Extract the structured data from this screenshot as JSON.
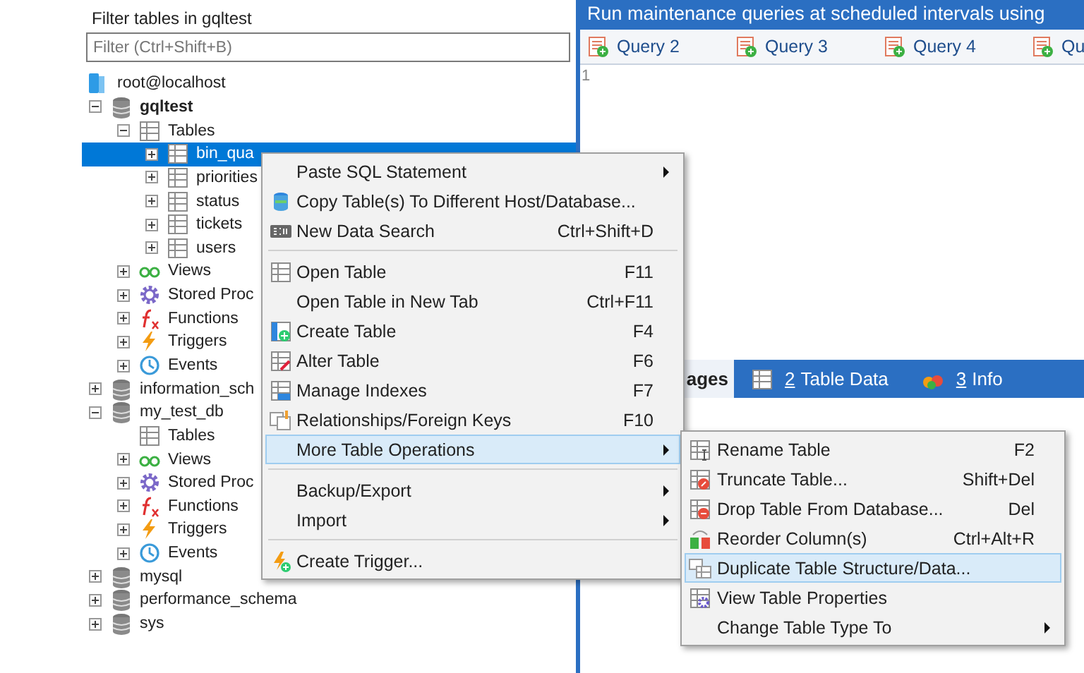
{
  "filter": {
    "label": "Filter tables in gqltest",
    "placeholder": "Filter (Ctrl+Shift+B)"
  },
  "tree": [
    {
      "label": "root@localhost",
      "kind": "server",
      "selected": false,
      "children": [
        {
          "label": "gqltest",
          "kind": "database",
          "bold": true,
          "expanded": true,
          "selected": false,
          "children": [
            {
              "label": "Tables",
              "kind": "tables",
              "expanded": true,
              "selected": false,
              "children": [
                {
                  "label": "bin_qua",
                  "kind": "table",
                  "expanded": false,
                  "selected": true
                },
                {
                  "label": "priorities",
                  "kind": "table",
                  "expanded": false,
                  "selected": false
                },
                {
                  "label": "status",
                  "kind": "table",
                  "expanded": false,
                  "selected": false
                },
                {
                  "label": "tickets",
                  "kind": "table",
                  "expanded": false,
                  "selected": false
                },
                {
                  "label": "users",
                  "kind": "table",
                  "expanded": false,
                  "selected": false
                }
              ]
            },
            {
              "label": "Views",
              "kind": "views",
              "expanded": false,
              "selected": false
            },
            {
              "label": "Stored Proc",
              "kind": "procs",
              "expanded": false,
              "selected": false
            },
            {
              "label": "Functions",
              "kind": "functions",
              "expanded": false,
              "selected": false
            },
            {
              "label": "Triggers",
              "kind": "triggers",
              "expanded": false,
              "selected": false
            },
            {
              "label": "Events",
              "kind": "events",
              "expanded": false,
              "selected": false
            }
          ]
        },
        {
          "label": "information_sch",
          "kind": "database",
          "expanded": false,
          "selected": false
        },
        {
          "label": "my_test_db",
          "kind": "database",
          "expanded": true,
          "selected": false,
          "children": [
            {
              "label": "Tables",
              "kind": "tables",
              "selected": false
            },
            {
              "label": "Views",
              "kind": "views",
              "expanded": false,
              "selected": false
            },
            {
              "label": "Stored Proc",
              "kind": "procs",
              "expanded": false,
              "selected": false
            },
            {
              "label": "Functions",
              "kind": "functions",
              "expanded": false,
              "selected": false
            },
            {
              "label": "Triggers",
              "kind": "triggers",
              "expanded": false,
              "selected": false
            },
            {
              "label": "Events",
              "kind": "events",
              "expanded": false,
              "selected": false
            }
          ]
        },
        {
          "label": "mysql",
          "kind": "database",
          "expanded": false,
          "selected": false
        },
        {
          "label": "performance_schema",
          "kind": "database",
          "expanded": false,
          "selected": false
        },
        {
          "label": "sys",
          "kind": "database",
          "expanded": false,
          "selected": false
        }
      ]
    }
  ],
  "header": {
    "title": "Run maintenance queries at scheduled intervals using"
  },
  "query_tabs": [
    {
      "label": "Query 2",
      "selected": false
    },
    {
      "label": "Query 3",
      "selected": false
    },
    {
      "label": "Query 4",
      "selected": false
    },
    {
      "label": "Qu",
      "selected": false
    }
  ],
  "editor": {
    "line_numbers": [
      "1"
    ]
  },
  "result_tabs": [
    {
      "label": "ages",
      "kind": "plain",
      "selected": true
    },
    {
      "number": "2",
      "label": "Table Data",
      "kind": "table",
      "selected": false
    },
    {
      "number": "3",
      "label": "Info",
      "kind": "info",
      "selected": false
    }
  ],
  "context_menu": {
    "items": [
      {
        "kind": "plain",
        "label": "Paste SQL Statement",
        "submenu": true,
        "selected": false
      },
      {
        "kind": "copy",
        "label": "Copy Table(s) To Different Host/Database...",
        "submenu": false,
        "selected": false
      },
      {
        "kind": "search",
        "label": "New Data Search",
        "shortcut": "Ctrl+Shift+D",
        "submenu": false,
        "selected": false
      },
      {
        "kind": "separator"
      },
      {
        "kind": "table",
        "label": "Open Table",
        "shortcut": "F11",
        "submenu": false,
        "selected": false
      },
      {
        "kind": "plain",
        "label": "Open Table in New Tab",
        "shortcut": "Ctrl+F11",
        "submenu": false,
        "selected": false
      },
      {
        "kind": "create",
        "label": "Create Table",
        "shortcut": "F4",
        "submenu": false,
        "selected": false
      },
      {
        "kind": "alter",
        "label": "Alter Table",
        "shortcut": "F6",
        "submenu": false,
        "selected": false
      },
      {
        "kind": "indexes",
        "label": "Manage Indexes",
        "shortcut": "F7",
        "submenu": false,
        "selected": false
      },
      {
        "kind": "relations",
        "label": "Relationships/Foreign Keys",
        "shortcut": "F10",
        "submenu": false,
        "selected": false
      },
      {
        "kind": "plain",
        "label": "More Table Operations",
        "submenu": true,
        "selected": true
      },
      {
        "kind": "separator"
      },
      {
        "kind": "plain",
        "label": "Backup/Export",
        "submenu": true,
        "selected": false
      },
      {
        "kind": "plain",
        "label": "Import",
        "submenu": true,
        "selected": false
      },
      {
        "kind": "separator"
      },
      {
        "kind": "trigger",
        "label": "Create Trigger...",
        "submenu": false,
        "selected": false
      }
    ]
  },
  "submenu": {
    "items": [
      {
        "kind": "rename",
        "label": "Rename Table",
        "shortcut": "F2",
        "submenu": false,
        "selected": false
      },
      {
        "kind": "truncate",
        "label": "Truncate Table...",
        "shortcut": "Shift+Del",
        "submenu": false,
        "selected": false
      },
      {
        "kind": "drop",
        "label": "Drop Table From Database...",
        "shortcut": "Del",
        "submenu": false,
        "selected": false
      },
      {
        "kind": "reorder",
        "label": "Reorder Column(s)",
        "shortcut": "Ctrl+Alt+R",
        "submenu": false,
        "selected": false
      },
      {
        "kind": "duplicate",
        "label": "Duplicate Table Structure/Data...",
        "submenu": false,
        "selected": true
      },
      {
        "kind": "properties",
        "label": "View Table Properties",
        "submenu": false,
        "selected": false
      },
      {
        "kind": "plain",
        "label": "Change Table Type To",
        "submenu": true,
        "selected": false
      }
    ]
  }
}
